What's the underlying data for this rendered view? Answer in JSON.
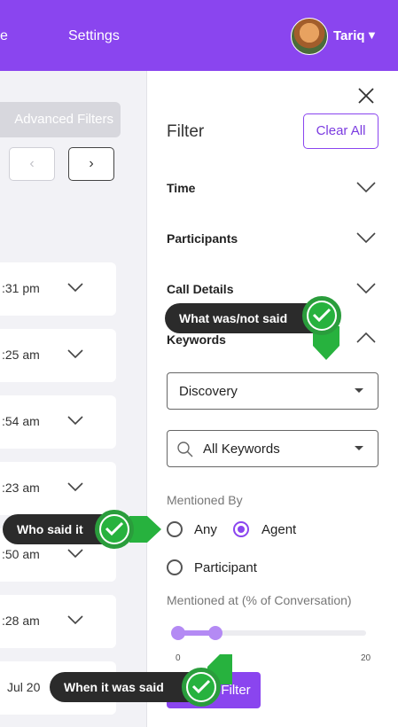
{
  "topbar": {
    "nav_partial": "e",
    "nav_settings": "Settings",
    "user_name": "Tariq"
  },
  "list": {
    "advanced_filters": "Advanced Filters",
    "rows": [
      ":31 pm",
      ":25 am",
      ":54 am",
      ":23 am",
      ":50 am",
      ":28 am",
      "Jul 20"
    ]
  },
  "filter": {
    "title": "Filter",
    "clear_all": "Clear All",
    "sections": [
      "Time",
      "Participants",
      "Call Details",
      "Keywords"
    ],
    "keyword_category": "Discovery",
    "keyword_select": "All Keywords",
    "mentioned_by_label": "Mentioned By",
    "mentioned_by_options": [
      "Any",
      "Agent",
      "Participant"
    ],
    "mentioned_by_selected": "Agent",
    "mentioned_at_label": "Mentioned at (% of Conversation)",
    "range_min_label": "0",
    "range_max_label": "20",
    "range_selected": [
      0,
      20
    ],
    "apply_label": "Filter"
  },
  "callouts": {
    "what": "What was/not said",
    "who": "Who said it",
    "when": "When it was said"
  },
  "colors": {
    "brand": "#8a45ef",
    "check": "#27b23e"
  }
}
